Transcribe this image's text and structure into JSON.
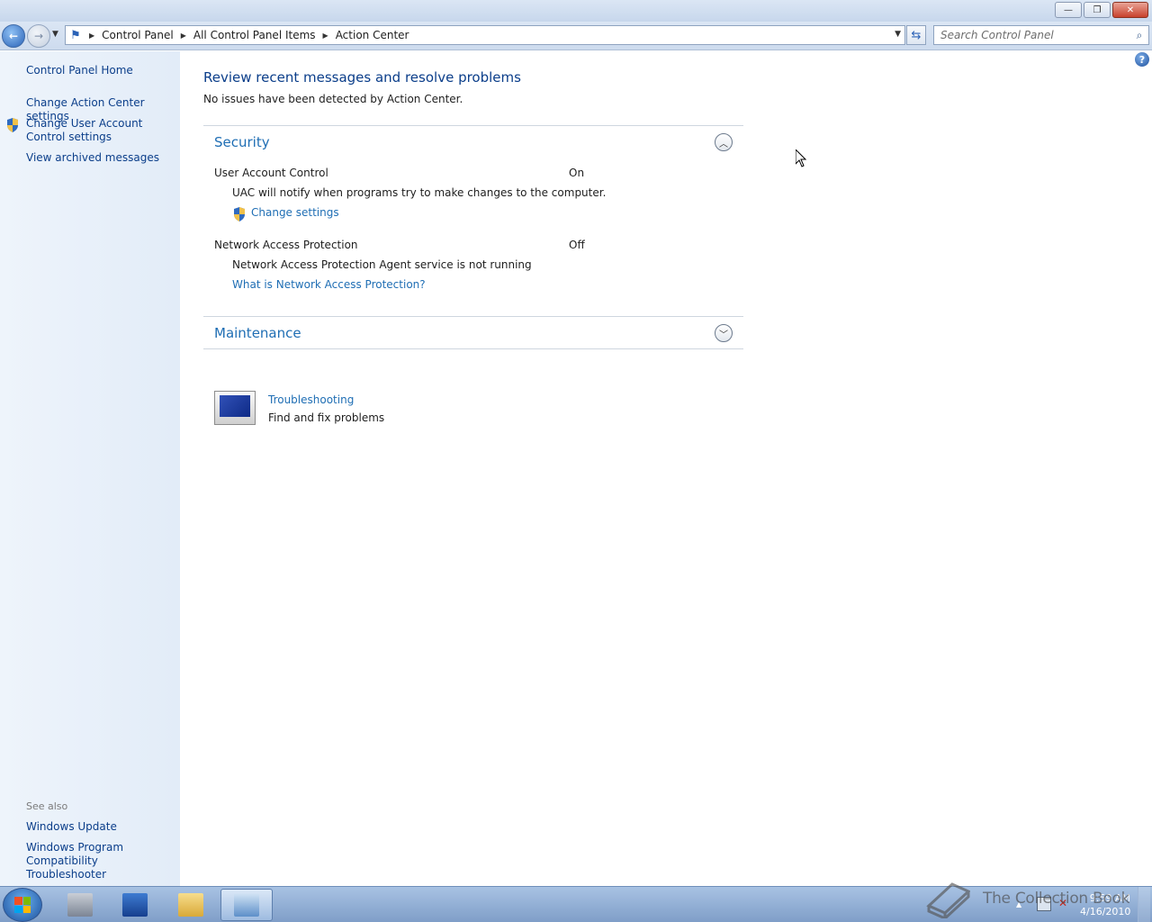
{
  "window": {
    "minimize_label": "—",
    "restore_label": "❐",
    "close_label": "✕"
  },
  "navigation": {
    "back_label": "←",
    "forward_label": "→",
    "breadcrumbs": [
      "Control Panel",
      "All Control Panel Items",
      "Action Center"
    ],
    "search_placeholder": "Search Control Panel"
  },
  "sidebar": {
    "home": "Control Panel Home",
    "items": [
      {
        "label": "Change Action Center settings"
      },
      {
        "label": "Change User Account Control settings"
      },
      {
        "label": "View archived messages"
      }
    ],
    "see_also_title": "See also",
    "see_also": [
      {
        "label": "Windows Update"
      },
      {
        "label": "Windows Program Compatibility Troubleshooter"
      }
    ]
  },
  "main": {
    "help_label": "?",
    "title": "Review recent messages and resolve problems",
    "subtitle": "No issues have been detected by Action Center.",
    "security": {
      "title": "Security",
      "uac": {
        "label": "User Account Control",
        "status": "On",
        "description": "UAC will notify when programs try to make changes to the computer.",
        "link": "Change settings"
      },
      "nap": {
        "label": "Network Access Protection",
        "status": "Off",
        "description": "Network Access Protection Agent service is not running",
        "link": "What is Network Access Protection?"
      }
    },
    "maintenance": {
      "title": "Maintenance"
    },
    "troubleshooting": {
      "link": "Troubleshooting",
      "description": "Find and fix problems"
    }
  },
  "taskbar": {
    "clock_time": "9:59 AM",
    "clock_date": "4/16/2010",
    "watermark": "The Collection Book"
  },
  "colors": {
    "link": "#1f6eb4",
    "nav_link": "#0b3e8a",
    "heading": "#0b3e8a"
  }
}
